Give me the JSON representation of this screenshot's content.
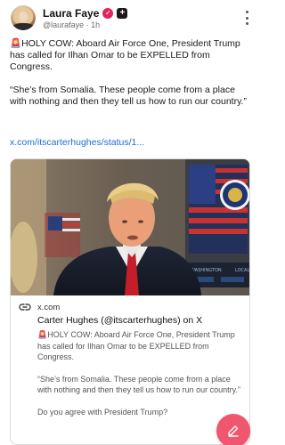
{
  "author": {
    "name": "Laura Faye",
    "handle": "@laurafaye",
    "separator": " · ",
    "time": "1h"
  },
  "post": {
    "paragraphs": [
      "🚨HOLY COW: Aboard Air Force One, President Trump has called for Ilhan Omar to be EXPELLED from Congress.",
      "“She’s from Somalia. These people come from a place with nothing and then they tell us how to run our country.”"
    ],
    "link_text": "x.com/itscarterhughes/status/1..."
  },
  "card": {
    "domain": "x.com",
    "title": "Carter Hughes (@itscarterhughes) on X",
    "description": [
      "🚨HOLY COW: Aboard Air Force One, President Trump has called for Ilhan Omar to be EXPELLED from Congress.",
      "“She’s from Somalia. These people come from a place with nothing and then they tell us how to run our country.”",
      "Do you agree with President Trump?"
    ],
    "screen_text_1": "WASHINGTON",
    "screen_text_2": "LOCAL"
  },
  "colors": {
    "accent_link": "#1a6fd6",
    "fab": "#f0566e",
    "verified": "#e0245e"
  },
  "icons": {
    "verified": "verified-badge-icon",
    "plus": "plus-badge-icon",
    "more": "more-vertical-icon",
    "link": "link-icon",
    "compose": "compose-icon"
  }
}
